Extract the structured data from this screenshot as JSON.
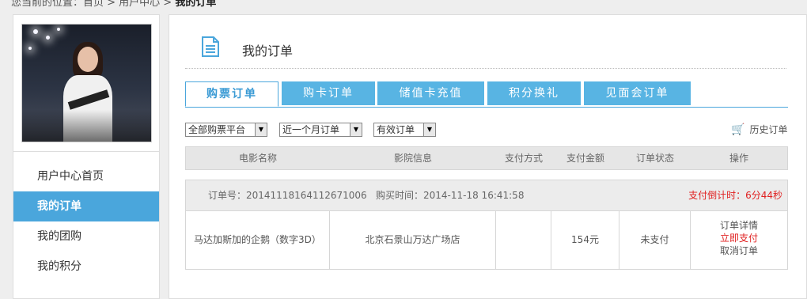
{
  "breadcrumb": {
    "text": "您当前的位置：首页 > 用户中心 > ",
    "current": "我的订单"
  },
  "sidebar": {
    "items": [
      {
        "label": "用户中心首页",
        "active": false
      },
      {
        "label": "我的订单",
        "active": true
      },
      {
        "label": "我的团购",
        "active": false
      },
      {
        "label": "我的积分",
        "active": false
      }
    ]
  },
  "main": {
    "title": "我的订单",
    "tabs": [
      {
        "label": "购票订单",
        "active": true
      },
      {
        "label": "购卡订单",
        "active": false
      },
      {
        "label": "储值卡充值",
        "active": false
      },
      {
        "label": "积分换礼",
        "active": false
      },
      {
        "label": "见面会订单",
        "active": false
      }
    ],
    "filters": {
      "platform": "全部购票平台",
      "range": "近一个月订单",
      "status": "有效订单"
    },
    "history_label": "历史订单",
    "columns": [
      "电影名称",
      "影院信息",
      "支付方式",
      "支付金额",
      "订单状态",
      "操作"
    ],
    "order": {
      "number_label": "订单号：20141118164112671006",
      "time_label": "购买时间：2014-11-18 16:41:58",
      "countdown_label": "支付倒计时：6分44秒",
      "movie": "马达加斯加的企鹅（数字3D）",
      "cinema": "北京石景山万达广场店",
      "payment_method": "",
      "amount": "154元",
      "status": "未支付",
      "actions": {
        "detail": "订单详情",
        "pay": "立即支付",
        "cancel": "取消订单"
      }
    }
  },
  "colors": {
    "accent": "#4aa6dc",
    "tab": "#58b4e3",
    "alert": "#e02020"
  }
}
